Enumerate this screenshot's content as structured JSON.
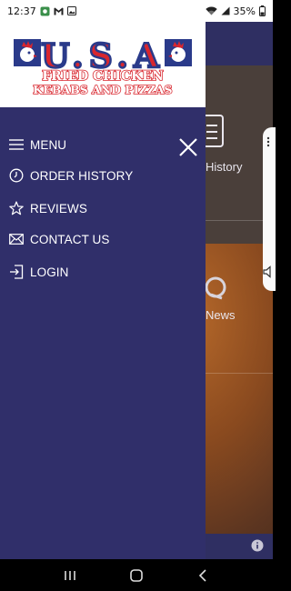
{
  "status_bar": {
    "time": "12:37",
    "battery": "35%",
    "icons": [
      "photo-notification-icon",
      "gmail-icon",
      "image-icon",
      "wifi-icon",
      "signal-icon",
      "battery-icon"
    ]
  },
  "drawer": {
    "logo": {
      "line1": "U.S.A",
      "line2": "FRIED CHICKEN",
      "line3": "KEBABS AND PIZZAS"
    },
    "items": [
      {
        "label": "MENU",
        "icon": "hamburger-icon"
      },
      {
        "label": "ORDER HISTORY",
        "icon": "clock-icon"
      },
      {
        "label": "REVIEWS",
        "icon": "star-icon"
      },
      {
        "label": "CONTACT US",
        "icon": "envelope-icon"
      },
      {
        "label": "LOGIN",
        "icon": "login-icon"
      }
    ]
  },
  "background": {
    "history_label": "History",
    "news_label": "News"
  },
  "colors": {
    "drawer_bg": "#302f6a",
    "logo_blue": "#2a3a8a",
    "logo_red": "#d8262e"
  }
}
